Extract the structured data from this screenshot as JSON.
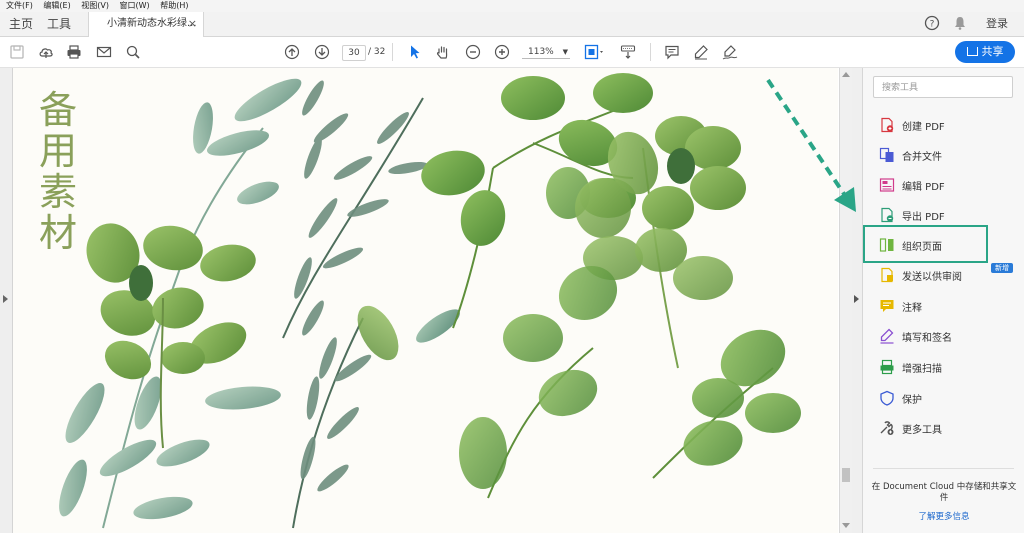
{
  "menu": [
    "文件(F)",
    "编辑(E)",
    "视图(V)",
    "窗口(W)",
    "帮助(H)"
  ],
  "tabs": {
    "home": "主页",
    "tools": "工具",
    "document": "小清新动态水彩绿...",
    "close": "×"
  },
  "header_right": {
    "help": "?",
    "login": "登录"
  },
  "toolbar": {
    "page_current": "30",
    "page_total": "/ 32",
    "zoom": "113%",
    "share_label": "共享"
  },
  "document": {
    "title_chars": [
      "备",
      "用",
      "素",
      "材"
    ]
  },
  "tools_panel": {
    "search_placeholder": "搜索工具",
    "items": [
      {
        "label": "创建 PDF",
        "icon": "create-pdf-icon",
        "color": "#d7373f"
      },
      {
        "label": "合并文件",
        "icon": "combine-files-icon",
        "color": "#4b5bd4"
      },
      {
        "label": "编辑 PDF",
        "icon": "edit-pdf-icon",
        "color": "#d13b8c"
      },
      {
        "label": "导出 PDF",
        "icon": "export-pdf-icon",
        "color": "#2d9d78"
      },
      {
        "label": "组织页面",
        "icon": "organize-pages-icon",
        "color": "#6fb53f"
      },
      {
        "label": "发送以供审阅",
        "icon": "send-review-icon",
        "color": "#e6b800"
      },
      {
        "label": "注释",
        "icon": "comment-icon",
        "color": "#e6b800"
      },
      {
        "label": "填写和签名",
        "icon": "fill-sign-icon",
        "color": "#8a4fd1"
      },
      {
        "label": "增强扫描",
        "icon": "enhance-scan-icon",
        "color": "#2d9d4a"
      },
      {
        "label": "保护",
        "icon": "protect-icon",
        "color": "#3b5bd4"
      },
      {
        "label": "更多工具",
        "icon": "more-tools-icon",
        "color": "#555555"
      }
    ],
    "new_badge": "新增",
    "cloud_text": "在 Document Cloud 中存储和共享文件",
    "cloud_link": "了解更多信息"
  },
  "colors": {
    "accent": "#1473e6",
    "highlight": "#2aa587",
    "title": "#8aa05a"
  }
}
